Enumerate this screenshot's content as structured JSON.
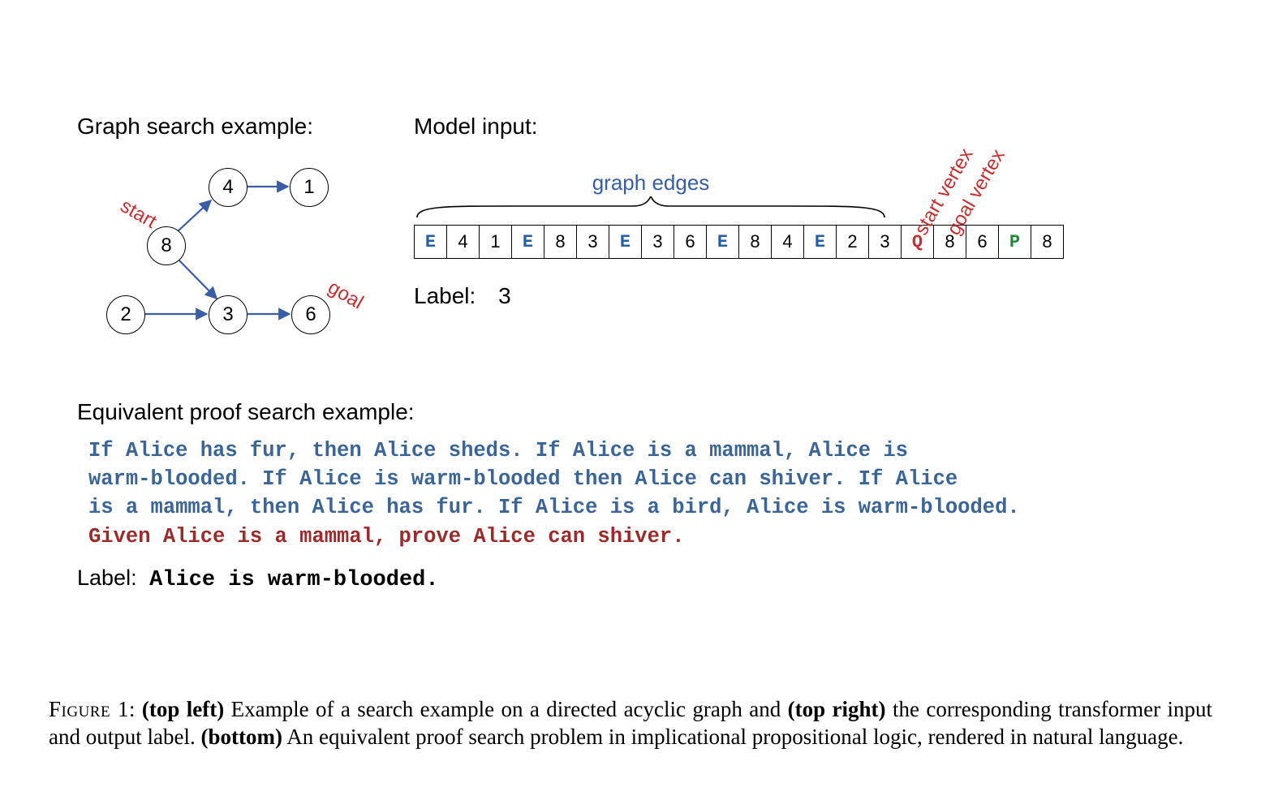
{
  "titles": {
    "graph": "Graph search example:",
    "model_input": "Model input:",
    "label_word": "Label:",
    "proof_title": "Equivalent proof search example:"
  },
  "graph": {
    "nodes": {
      "n4": "4",
      "n1": "1",
      "n8": "8",
      "n2": "2",
      "n3": "3",
      "n6": "6"
    },
    "tags": {
      "start": "start",
      "goal": "goal"
    }
  },
  "input_strip": {
    "brace_label": "graph edges",
    "diag_labels": {
      "start": "start vertex",
      "goal": "goal vertex"
    },
    "tokens": [
      {
        "t": "E",
        "cls": "E"
      },
      {
        "t": "4",
        "cls": "num"
      },
      {
        "t": "1",
        "cls": "num"
      },
      {
        "t": "E",
        "cls": "E"
      },
      {
        "t": "8",
        "cls": "num"
      },
      {
        "t": "3",
        "cls": "num"
      },
      {
        "t": "E",
        "cls": "E"
      },
      {
        "t": "3",
        "cls": "num"
      },
      {
        "t": "6",
        "cls": "num"
      },
      {
        "t": "E",
        "cls": "E"
      },
      {
        "t": "8",
        "cls": "num"
      },
      {
        "t": "4",
        "cls": "num"
      },
      {
        "t": "E",
        "cls": "E"
      },
      {
        "t": "2",
        "cls": "num"
      },
      {
        "t": "3",
        "cls": "num"
      },
      {
        "t": "Q",
        "cls": "Q"
      },
      {
        "t": "8",
        "cls": "num"
      },
      {
        "t": "6",
        "cls": "num"
      },
      {
        "t": "P",
        "cls": "P"
      },
      {
        "t": "8",
        "cls": "num"
      }
    ]
  },
  "top_label_value": "3",
  "proof": {
    "lines_blue": [
      "If Alice has fur, then Alice sheds. If Alice is a mammal, Alice is",
      "warm-blooded. If Alice is warm-blooded then Alice can shiver. If Alice",
      "is a mammal, then Alice has fur. If Alice is a bird, Alice is warm-blooded."
    ],
    "line_red": "Given Alice is a mammal, prove Alice can shiver.",
    "answer": "Alice is warm-blooded."
  },
  "caption": {
    "fignum": "Figure 1",
    "b1": "(top left)",
    "t1": " Example of a search example on a directed acyclic graph and ",
    "b2": "(top right)",
    "t2": " the corresponding transformer input and output label. ",
    "b3": "(bottom)",
    "t3": " An equivalent proof search problem in implicational propositional logic, rendered in natural language."
  }
}
